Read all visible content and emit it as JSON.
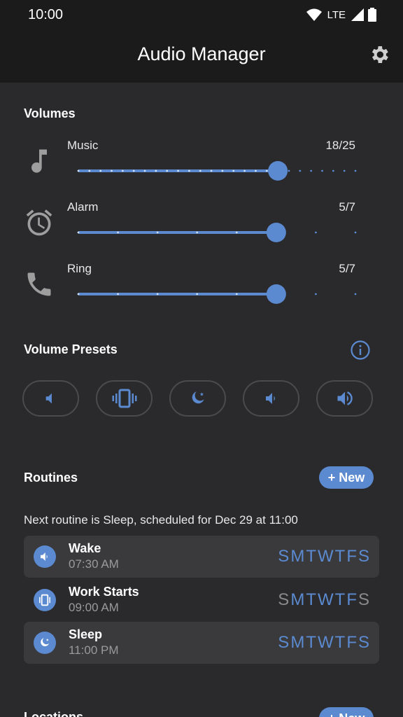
{
  "status": {
    "time": "10:00",
    "network": "LTE"
  },
  "header": {
    "title": "Audio Manager"
  },
  "volumes": {
    "title": "Volumes",
    "items": [
      {
        "label": "Music",
        "value_text": "18/25",
        "level": 18,
        "max": 25,
        "icon": "music-note-icon"
      },
      {
        "label": "Alarm",
        "value_text": "5/7",
        "level": 5,
        "max": 7,
        "icon": "alarm-clock-icon"
      },
      {
        "label": "Ring",
        "value_text": "5/7",
        "level": 5,
        "max": 7,
        "icon": "phone-icon"
      }
    ]
  },
  "presets": {
    "title": "Volume Presets",
    "items": [
      {
        "icon": "mute-icon"
      },
      {
        "icon": "vibrate-icon"
      },
      {
        "icon": "do-not-disturb-moon-icon"
      },
      {
        "icon": "volume-low-icon"
      },
      {
        "icon": "volume-high-icon"
      }
    ]
  },
  "routines": {
    "title": "Routines",
    "new_label": "+ New",
    "next_text": "Next routine is Sleep, scheduled for Dec 29 at 11:00",
    "items": [
      {
        "name": "Wake",
        "time": "07:30 AM",
        "enabled": true,
        "icon": "volume-low-icon",
        "days": [
          {
            "d": "S",
            "on": true
          },
          {
            "d": "M",
            "on": true
          },
          {
            "d": "T",
            "on": true
          },
          {
            "d": "W",
            "on": true
          },
          {
            "d": "T",
            "on": true
          },
          {
            "d": "F",
            "on": true
          },
          {
            "d": "S",
            "on": true
          }
        ]
      },
      {
        "name": "Work Starts",
        "time": "09:00 AM",
        "enabled": false,
        "icon": "vibrate-icon",
        "days": [
          {
            "d": "S",
            "on": false
          },
          {
            "d": "M",
            "on": true
          },
          {
            "d": "T",
            "on": true
          },
          {
            "d": "W",
            "on": true
          },
          {
            "d": "T",
            "on": true
          },
          {
            "d": "F",
            "on": true
          },
          {
            "d": "S",
            "on": false
          }
        ]
      },
      {
        "name": "Sleep",
        "time": "11:00 PM",
        "enabled": true,
        "icon": "do-not-disturb-moon-icon",
        "days": [
          {
            "d": "S",
            "on": true
          },
          {
            "d": "M",
            "on": true
          },
          {
            "d": "T",
            "on": true
          },
          {
            "d": "W",
            "on": true
          },
          {
            "d": "T",
            "on": true
          },
          {
            "d": "F",
            "on": true
          },
          {
            "d": "S",
            "on": true
          }
        ]
      }
    ]
  },
  "locations": {
    "title": "Locations",
    "new_label": "+ New"
  },
  "colors": {
    "accent": "#5b8ad0",
    "background": "#2a2a2c",
    "bar": "#1b1b1c"
  }
}
